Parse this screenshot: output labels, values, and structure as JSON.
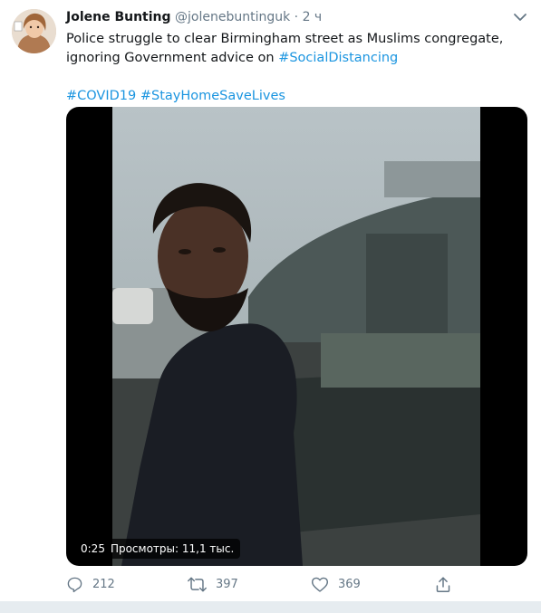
{
  "tweet": {
    "author": {
      "name": "Jolene Bunting",
      "handle": "@jolenebuntinguk",
      "separator": "·",
      "time": "2 ч"
    },
    "text": {
      "line1": "Police struggle to clear Birmingham street as Muslims congregate,",
      "line2_prefix": "ignoring Government advice on ",
      "hashtag_social": "#SocialDistancing",
      "hashtag_covid": "#COVID19",
      "hashtag_stayhome": "#StayHomeSaveLives"
    },
    "video": {
      "duration": "0:25",
      "views": "Просмотры: 11,1 тыс."
    },
    "actions": {
      "replies": "212",
      "retweets": "397",
      "likes": "369"
    }
  },
  "icons": {
    "caret": "chevron-down-icon",
    "reply": "reply-icon",
    "retweet": "retweet-icon",
    "like": "heart-icon",
    "share": "share-icon"
  },
  "colors": {
    "link": "#1b95e0",
    "muted": "#657786",
    "text": "#14171a",
    "background_strip": "#e6ecf0"
  }
}
